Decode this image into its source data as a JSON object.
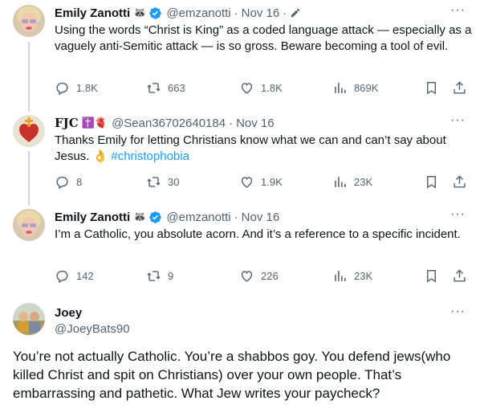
{
  "tweets": [
    {
      "name": "Emily Zanotti",
      "name_emoji": "🦝",
      "handle": "@emzanotti",
      "separator": "·",
      "date": "Nov 16",
      "text": "Using the words “Christ is King” as a coded language attack — especially as a vaguely anti-Semitic attack — is so gross. Beware becoming a tool of evil.",
      "replies": "1.8K",
      "retweets": "663",
      "likes": "1.8K",
      "views": "869K"
    },
    {
      "name": "FJC",
      "name_emoji": "✝️🫀",
      "handle": "@Sean36702640184",
      "separator": "·",
      "date": "Nov 16",
      "text_before": "Thanks Emily for letting Christians know what we can and can’t say about Jesus. 👌",
      "hashtag": "#christophobia",
      "replies": "8",
      "retweets": "30",
      "likes": "1.9K",
      "views": "23K"
    },
    {
      "name": "Emily Zanotti",
      "name_emoji": "🦝",
      "handle": "@emzanotti",
      "separator": "·",
      "date": "Nov 16",
      "text": "I’m a Catholic, you absolute acorn. And it’s a reference to a specific incident.",
      "replies": "142",
      "retweets": "9",
      "likes": "226",
      "views": "23K"
    }
  ],
  "main_tweet": {
    "name": "Joey",
    "handle": "@JoeyBats90",
    "text": "You’re not actually Catholic. You’re a shabbos goy. You defend jews(who killed Christ and spit on Christians) over your own people. That’s embarrassing and pathetic. What Jew writes your paycheck?"
  },
  "more_label": "···",
  "colors": {
    "accent": "#1d9bf0",
    "muted": "#536471",
    "text": "#0f1419",
    "line": "#cfd9de"
  }
}
